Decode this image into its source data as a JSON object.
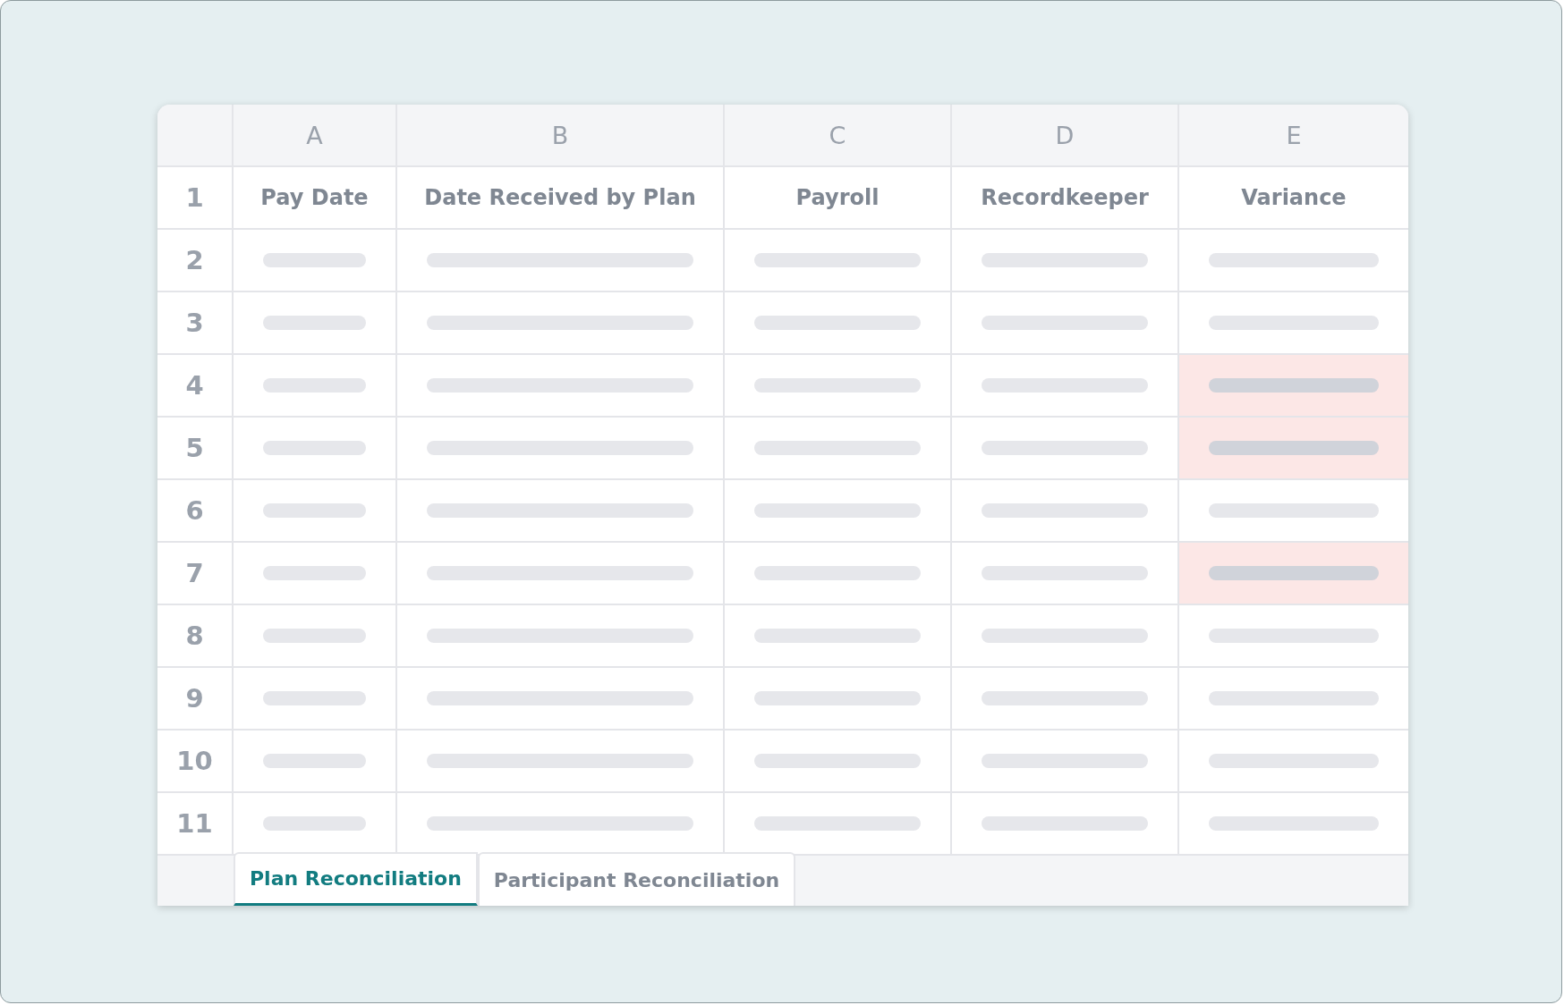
{
  "sheet": {
    "column_letters": [
      "A",
      "B",
      "C",
      "D",
      "E"
    ],
    "header_row": {
      "number": "1",
      "cells": [
        "Pay Date",
        "Date Received by Plan",
        "Payroll",
        "Recordkeeper",
        "Variance"
      ]
    },
    "rows": [
      {
        "number": "2",
        "variance_flagged": false
      },
      {
        "number": "3",
        "variance_flagged": false
      },
      {
        "number": "4",
        "variance_flagged": true
      },
      {
        "number": "5",
        "variance_flagged": true
      },
      {
        "number": "6",
        "variance_flagged": false
      },
      {
        "number": "7",
        "variance_flagged": true
      },
      {
        "number": "8",
        "variance_flagged": false
      },
      {
        "number": "9",
        "variance_flagged": false
      },
      {
        "number": "10",
        "variance_flagged": false
      },
      {
        "number": "11",
        "variance_flagged": false
      }
    ]
  },
  "tabs": [
    {
      "label": "Plan Reconciliation",
      "selected": true
    },
    {
      "label": "Participant Reconciliation",
      "selected": false
    }
  ]
}
